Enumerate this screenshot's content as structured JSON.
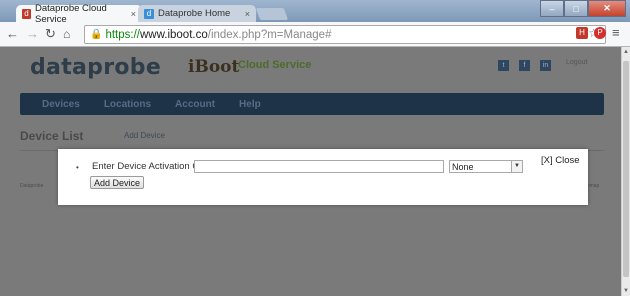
{
  "browser": {
    "tabs": [
      {
        "label": "Dataprobe Cloud Service",
        "active": true,
        "favicon": "dataprobe-favicon"
      },
      {
        "label": "Dataprobe Home",
        "active": false,
        "favicon": "dataprobe-home-favicon"
      }
    ],
    "tab_close": "×",
    "url": {
      "scheme": "https://",
      "host": "www.iboot.co",
      "path": "/index.php?m=Manage#"
    }
  },
  "site": {
    "logo": "dataprobe",
    "product_logo": "iBoot",
    "product_subtitle": "Cloud Service",
    "logout": "Logout",
    "nav": [
      "Devices",
      "Locations",
      "Account",
      "Help"
    ],
    "section_title": "Device List",
    "add_device_link": "Add Device",
    "footer_left": "Dataprobe",
    "footer_right": "Sitemap"
  },
  "modal": {
    "label": "Enter Device Activation Code",
    "input_value": "",
    "select_value": "None",
    "button": "Add Device",
    "close": "[X] Close"
  },
  "colors": {
    "navbar": "#1e3248",
    "overlay": "#7a7a7a",
    "url_scheme": "#0a8a0a"
  }
}
